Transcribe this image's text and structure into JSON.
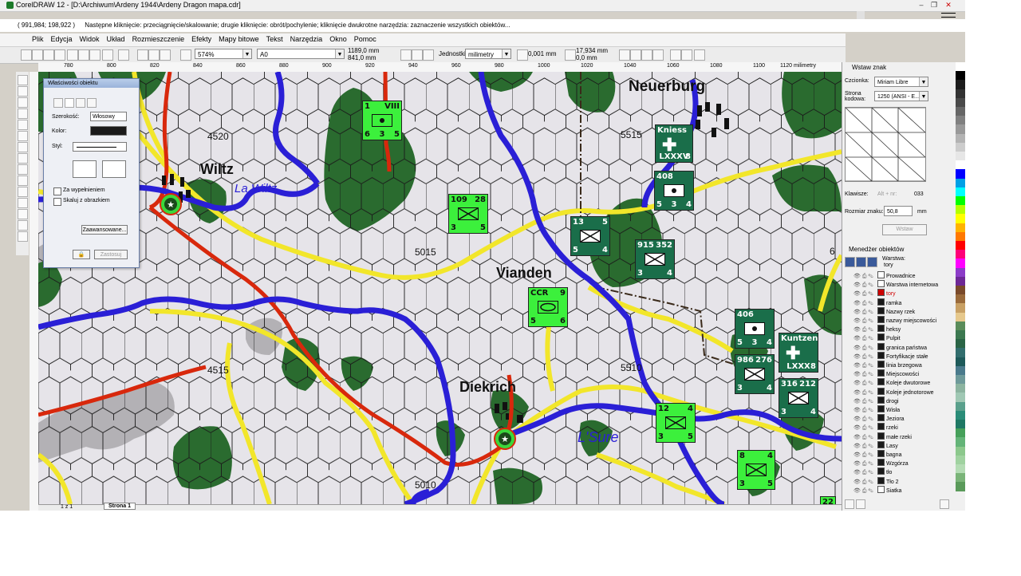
{
  "window": {
    "title": "CorelDRAW 12 - [D:\\Archiwum\\Ardeny 1944\\Ardeny Dragon mapa.cdr]",
    "hint_coords": "( 991,984; 198,922 )",
    "hint_text": "Następne kliknięcie: przeciągnięcie/skalowanie; drugie kliknięcie: obrót/pochylenie; kliknięcie dwukrotne narzędzia: zaznaczenie wszystkich obiektów..."
  },
  "menu": [
    "Plik",
    "Edycja",
    "Widok",
    "Układ",
    "Rozmieszczenie",
    "Efekty",
    "Mapy bitowe",
    "Tekst",
    "Narzędzia",
    "Okno",
    "Pomoc"
  ],
  "toolbar": {
    "zoom": "574%",
    "page_size": "A0",
    "width": "1189,0 mm",
    "height": "841,0 mm",
    "units_label": "Jednostki:",
    "units": "milimetry",
    "nudge": "0,001 mm",
    "dup_x": "17,934 mm",
    "dup_y": "0,0 mm"
  },
  "ruler": [
    "780",
    "800",
    "820",
    "840",
    "860",
    "880",
    "900",
    "920",
    "940",
    "960",
    "980",
    "1000",
    "1020",
    "1040",
    "1060",
    "1080",
    "1100",
    "1120 milimetry"
  ],
  "props_dialog": {
    "title": "Właściwości obiektu",
    "width_label": "Szerokość:",
    "width_value": "Włosowy",
    "color_label": "Kolor:",
    "style_label": "Styl:",
    "behind_fill": "Za wypełnieniem",
    "scale_with_image": "Skaluj z obrazkiem",
    "advanced": "Zaawansowane...",
    "apply": "Zastosuj"
  },
  "insert_char": {
    "title": "Wstaw znak",
    "font_label": "Czcionka:",
    "font": "Miriam Libre",
    "codepage_label": "Strona kodowa:",
    "codepage": "1250 (ANSI - E...",
    "keys_label": "Klawisze:",
    "alt_label": "Alt + nr:",
    "alt_value": "033",
    "size_label": "Rozmiar znaku:",
    "size_value": "50,8",
    "size_unit": "mm",
    "insert_button": "Wstaw"
  },
  "object_manager": {
    "title": "Menedżer obiektów",
    "layer_label": "Warstwa:",
    "layer_value": "tory",
    "layers": [
      {
        "name": "Prowadnice",
        "color": "#ffffff",
        "active": false
      },
      {
        "name": "Warstwa internetowa",
        "color": "#ffffff",
        "active": false
      },
      {
        "name": "tory",
        "color": "#cc0000",
        "active": true
      },
      {
        "name": "ramka",
        "color": "#1a1a1a",
        "active": false
      },
      {
        "name": "Nazwy rzek",
        "color": "#1a1a1a",
        "active": false
      },
      {
        "name": "nazwy miejscowości",
        "color": "#1a1a1a",
        "active": false
      },
      {
        "name": "heksy",
        "color": "#1a1a1a",
        "active": false
      },
      {
        "name": "Pulpit",
        "color": "#1a1a1a",
        "active": false
      },
      {
        "name": "granica państwa",
        "color": "#1a1a1a",
        "active": false
      },
      {
        "name": "Fortyfikacje stałe",
        "color": "#1a1a1a",
        "active": false
      },
      {
        "name": "linia brzegowa",
        "color": "#1a1a1a",
        "active": false
      },
      {
        "name": "Miejscowości",
        "color": "#1a1a1a",
        "active": false
      },
      {
        "name": "Koleje dwutorowe",
        "color": "#1a1a1a",
        "active": false
      },
      {
        "name": "Koleje jednotorowe",
        "color": "#1a1a1a",
        "active": false
      },
      {
        "name": "drogi",
        "color": "#1a1a1a",
        "active": false
      },
      {
        "name": "Wisła",
        "color": "#1a1a1a",
        "active": false
      },
      {
        "name": "Jeziora",
        "color": "#1a1a1a",
        "active": false
      },
      {
        "name": "rzeki",
        "color": "#1a1a1a",
        "active": false
      },
      {
        "name": "małe rzeki",
        "color": "#1a1a1a",
        "active": false
      },
      {
        "name": "Lasy",
        "color": "#1a1a1a",
        "active": false
      },
      {
        "name": "bagna",
        "color": "#1a1a1a",
        "active": false
      },
      {
        "name": "Wzgórza",
        "color": "#1a1a1a",
        "active": false
      },
      {
        "name": "tło",
        "color": "#1a1a1a",
        "active": false
      },
      {
        "name": "Tło 2",
        "color": "#1a1a1a",
        "active": false
      },
      {
        "name": "Siatka",
        "color": "#ffffff",
        "active": false
      }
    ]
  },
  "page_tab": "Strona 1",
  "page_counter": "1 z 1",
  "map": {
    "towns": [
      "Neuerburg",
      "Wiltz",
      "Vianden",
      "Diekrich"
    ],
    "rivers": [
      "La Wiltz",
      "L'Sure"
    ],
    "hex_numbers": [
      "4520",
      "5515",
      "5015",
      "4515",
      "5510",
      "5010",
      "6"
    ]
  },
  "counters": [
    {
      "id": "c1",
      "tl": "1",
      "tr": "VIII",
      "bl": "6",
      "bm": "3",
      "br": "5",
      "symbol": "dot",
      "theme": "light"
    },
    {
      "id": "c2",
      "tl": "109",
      "tr": "28",
      "bl": "3",
      "bm": "",
      "br": "5",
      "symbol": "cross",
      "theme": "light"
    },
    {
      "id": "c3",
      "tl": "Kniess",
      "tr": "",
      "bl": "",
      "bm": "LXXXV",
      "br": "8",
      "symbol": "iron",
      "theme": "dark"
    },
    {
      "id": "c4",
      "tl": "408",
      "tr": "",
      "bl": "5",
      "bm": "3",
      "br": "4",
      "symbol": "dot",
      "theme": "dark"
    },
    {
      "id": "c5",
      "tl": "13",
      "tr": "5",
      "bl": "5",
      "bm": "",
      "br": "4",
      "symbol": "cross",
      "theme": "dark"
    },
    {
      "id": "c6",
      "tl": "915",
      "tr": "352",
      "bl": "3",
      "bm": "",
      "br": "4",
      "symbol": "cross",
      "theme": "dark"
    },
    {
      "id": "c7",
      "tl": "CCR",
      "tr": "9",
      "bl": "5",
      "bm": "",
      "br": "6",
      "symbol": "oval",
      "theme": "light"
    },
    {
      "id": "c8",
      "tl": "406",
      "tr": "",
      "bl": "5",
      "bm": "3",
      "br": "4",
      "symbol": "dot",
      "theme": "dark"
    },
    {
      "id": "c9",
      "tl": "Kuntzen",
      "tr": "",
      "bl": "",
      "bm": "LXXX",
      "br": "8",
      "symbol": "iron",
      "theme": "dark"
    },
    {
      "id": "c10",
      "tl": "986",
      "tr": "276",
      "bl": "3",
      "bm": "",
      "br": "4",
      "symbol": "cross",
      "theme": "dark"
    },
    {
      "id": "c11",
      "tl": "316",
      "tr": "212",
      "bl": "3",
      "bm": "",
      "br": "4",
      "symbol": "cross",
      "theme": "dark"
    },
    {
      "id": "c12",
      "tl": "12",
      "tr": "4",
      "bl": "3",
      "bm": "",
      "br": "5",
      "symbol": "cross",
      "theme": "light"
    },
    {
      "id": "c13",
      "tl": "8",
      "tr": "4",
      "bl": "3",
      "bm": "",
      "br": "5",
      "symbol": "cross",
      "theme": "light"
    },
    {
      "id": "c14",
      "tl": "22",
      "tr": "",
      "bl": "",
      "bm": "",
      "br": "",
      "symbol": "none",
      "theme": "light"
    }
  ],
  "colors": {
    "map_bg": "#e6e4e9",
    "forest": "#2a6b2f",
    "river": "#2a1fd6",
    "road": "#f2e62a",
    "rail": "#d8280c",
    "counter_light": "#3cf03c",
    "counter_dark": "#1a6e4a"
  },
  "palette": [
    "#ffffff",
    "#000000",
    "#1c1c1c",
    "#333333",
    "#4a4a4a",
    "#666666",
    "#808080",
    "#999999",
    "#b3b3b3",
    "#cccccc",
    "#e6e6e6",
    "#ffffff",
    "#0000ff",
    "#00a0e6",
    "#00ffff",
    "#00ff00",
    "#b4ff00",
    "#ffff00",
    "#ffb400",
    "#ff7800",
    "#ff0000",
    "#ff0078",
    "#ff00ff",
    "#8c3cc8",
    "#6e2896",
    "#7a4a2a",
    "#9a6a3a",
    "#c8a064",
    "#e6c88c",
    "#5a8c5a",
    "#3c7850",
    "#2a6446",
    "#326e6e",
    "#1e5a5a",
    "#4a7a8c",
    "#6e9a9a",
    "#8cb4a0",
    "#a0c8b4",
    "#5aa08c",
    "#2a8c78",
    "#1e7864",
    "#46a05a",
    "#64b478",
    "#8cc88c",
    "#a0d2a0",
    "#b4dcb4",
    "#7ab478",
    "#5a9a5a"
  ]
}
